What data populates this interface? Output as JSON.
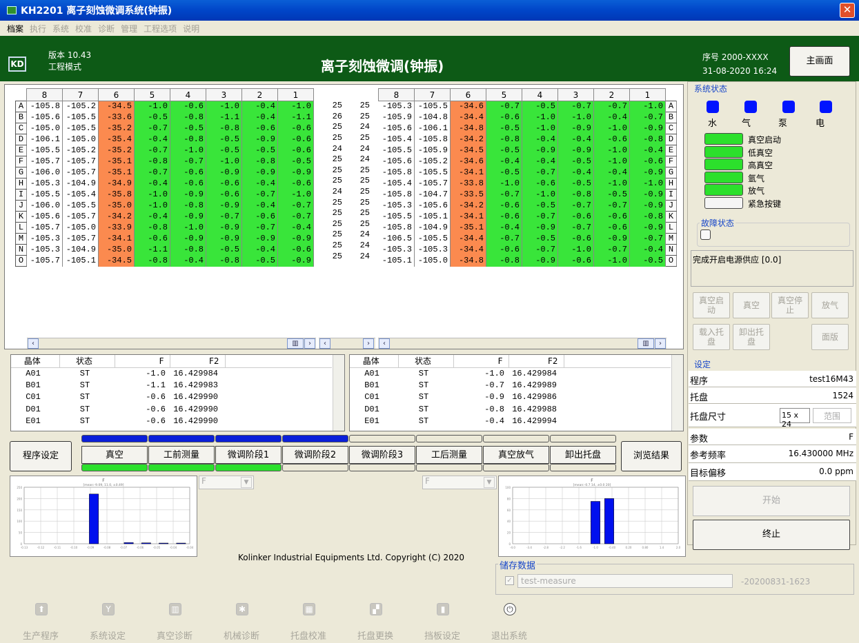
{
  "window": {
    "title": "KH2201 离子刻蚀微调系统(钟振)",
    "close": "✕"
  },
  "menu": [
    "档案",
    "执行",
    "系统",
    "校准",
    "诊断",
    "管理",
    "工程选项",
    "说明"
  ],
  "header": {
    "version": "版本 10.43",
    "mode": "工程模式",
    "title": "离子刻蚀微调(钟振)",
    "serial": "序号 2000-XXXX",
    "datetime": "31-08-2020 16:24",
    "main_button": "主画面"
  },
  "grid": {
    "columns": [
      "8",
      "7",
      "6",
      "5",
      "4",
      "3",
      "2",
      "1"
    ],
    "rows": [
      "A",
      "B",
      "C",
      "D",
      "E",
      "F",
      "G",
      "H",
      "I",
      "J",
      "K",
      "L",
      "M",
      "N",
      "O"
    ],
    "left": [
      [
        "-105.8",
        "-105.2",
        "-34.5",
        "-1.0",
        "-0.6",
        "-1.0",
        "-0.4",
        "-1.0"
      ],
      [
        "-105.6",
        "-105.5",
        "-33.6",
        "-0.5",
        "-0.8",
        "-1.1",
        "-0.4",
        "-1.1"
      ],
      [
        "-105.0",
        "-105.5",
        "-35.2",
        "-0.7",
        "-0.5",
        "-0.8",
        "-0.6",
        "-0.6"
      ],
      [
        "-106.1",
        "-105.0",
        "-35.4",
        "-0.4",
        "-0.8",
        "-0.5",
        "-0.9",
        "-0.6"
      ],
      [
        "-105.5",
        "-105.2",
        "-35.2",
        "-0.7",
        "-1.0",
        "-0.5",
        "-0.5",
        "-0.6"
      ],
      [
        "-105.7",
        "-105.7",
        "-35.1",
        "-0.8",
        "-0.7",
        "-1.0",
        "-0.8",
        "-0.5"
      ],
      [
        "-106.0",
        "-105.7",
        "-35.1",
        "-0.7",
        "-0.6",
        "-0.9",
        "-0.9",
        "-0.9"
      ],
      [
        "-105.3",
        "-104.9",
        "-34.9",
        "-0.4",
        "-0.6",
        "-0.6",
        "-0.4",
        "-0.6"
      ],
      [
        "-105.5",
        "-105.4",
        "-35.8",
        "-1.0",
        "-0.9",
        "-0.6",
        "-0.7",
        "-1.0"
      ],
      [
        "-106.0",
        "-105.5",
        "-35.0",
        "-1.0",
        "-0.8",
        "-0.9",
        "-0.4",
        "-0.7"
      ],
      [
        "-105.6",
        "-105.7",
        "-34.2",
        "-0.4",
        "-0.9",
        "-0.7",
        "-0.6",
        "-0.7"
      ],
      [
        "-105.7",
        "-105.0",
        "-33.9",
        "-0.8",
        "-1.0",
        "-0.9",
        "-0.7",
        "-0.4"
      ],
      [
        "-105.3",
        "-105.7",
        "-34.1",
        "-0.6",
        "-0.9",
        "-0.9",
        "-0.9",
        "-0.9"
      ],
      [
        "-105.3",
        "-104.9",
        "-35.0",
        "-1.1",
        "-0.8",
        "-0.5",
        "-0.4",
        "-0.6"
      ],
      [
        "-105.7",
        "-105.1",
        "-34.5",
        "-0.8",
        "-0.4",
        "-0.8",
        "-0.5",
        "-0.9"
      ]
    ],
    "middle": [
      [
        "25",
        "25"
      ],
      [
        "26",
        "25"
      ],
      [
        "25",
        "24"
      ],
      [
        "25",
        "25"
      ],
      [
        "24",
        "24"
      ],
      [
        "25",
        "24"
      ],
      [
        "25",
        "25"
      ],
      [
        "25",
        "25"
      ],
      [
        "24",
        "25"
      ],
      [
        "25",
        "25"
      ],
      [
        "25",
        "25"
      ],
      [
        "25",
        "25"
      ],
      [
        "25",
        "24"
      ],
      [
        "25",
        "24"
      ],
      [
        "25",
        "24"
      ]
    ],
    "right": [
      [
        "-105.3",
        "-105.5",
        "-34.6",
        "-0.7",
        "-0.5",
        "-0.7",
        "-0.7",
        "-1.0"
      ],
      [
        "-105.9",
        "-104.8",
        "-34.4",
        "-0.6",
        "-1.0",
        "-1.0",
        "-0.4",
        "-0.7"
      ],
      [
        "-105.6",
        "-106.1",
        "-34.8",
        "-0.5",
        "-1.0",
        "-0.9",
        "-1.0",
        "-0.9"
      ],
      [
        "-105.4",
        "-105.8",
        "-34.2",
        "-0.8",
        "-0.4",
        "-0.4",
        "-0.6",
        "-0.8"
      ],
      [
        "-105.5",
        "-105.9",
        "-34.5",
        "-0.5",
        "-0.9",
        "-0.9",
        "-1.0",
        "-0.4"
      ],
      [
        "-105.6",
        "-105.2",
        "-34.6",
        "-0.4",
        "-0.4",
        "-0.5",
        "-1.0",
        "-0.6"
      ],
      [
        "-105.8",
        "-105.5",
        "-34.1",
        "-0.5",
        "-0.7",
        "-0.4",
        "-0.4",
        "-0.9"
      ],
      [
        "-105.4",
        "-105.7",
        "-33.8",
        "-1.0",
        "-0.6",
        "-0.5",
        "-1.0",
        "-1.0"
      ],
      [
        "-105.8",
        "-104.7",
        "-33.5",
        "-0.7",
        "-1.0",
        "-0.8",
        "-0.5",
        "-0.9"
      ],
      [
        "-105.3",
        "-105.6",
        "-34.2",
        "-0.6",
        "-0.5",
        "-0.7",
        "-0.7",
        "-0.9"
      ],
      [
        "-105.5",
        "-105.1",
        "-34.1",
        "-0.6",
        "-0.7",
        "-0.6",
        "-0.6",
        "-0.8"
      ],
      [
        "-105.8",
        "-104.9",
        "-35.1",
        "-0.4",
        "-0.9",
        "-0.7",
        "-0.6",
        "-0.9"
      ],
      [
        "-106.5",
        "-105.5",
        "-34.4",
        "-0.7",
        "-0.5",
        "-0.6",
        "-0.9",
        "-0.7"
      ],
      [
        "-105.3",
        "-105.3",
        "-34.4",
        "-0.6",
        "-0.7",
        "-1.0",
        "-0.7",
        "-0.4"
      ],
      [
        "-105.1",
        "-105.0",
        "-34.8",
        "-0.8",
        "-0.9",
        "-0.6",
        "-1.0",
        "-0.5"
      ]
    ]
  },
  "crystal_table": {
    "headers": [
      "晶体",
      "状态",
      "F",
      "F2"
    ],
    "left": [
      [
        "A01",
        "ST",
        "-1.0",
        "16.429984"
      ],
      [
        "B01",
        "ST",
        "-1.1",
        "16.429983"
      ],
      [
        "C01",
        "ST",
        "-0.6",
        "16.429990"
      ],
      [
        "D01",
        "ST",
        "-0.6",
        "16.429990"
      ],
      [
        "E01",
        "ST",
        "-0.6",
        "16.429990"
      ]
    ],
    "right": [
      [
        "A01",
        "ST",
        "-1.0",
        "16.429984"
      ],
      [
        "B01",
        "ST",
        "-0.7",
        "16.429989"
      ],
      [
        "C01",
        "ST",
        "-0.9",
        "16.429986"
      ],
      [
        "D01",
        "ST",
        "-0.8",
        "16.429988"
      ],
      [
        "E01",
        "ST",
        "-0.4",
        "16.429994"
      ]
    ]
  },
  "stages": {
    "program_button": "程序设定",
    "browse_button": "浏览结果",
    "items": [
      {
        "label": "真空",
        "top": "#0a1fd9",
        "bottom": "#2ce02c"
      },
      {
        "label": "工前测量",
        "top": "#0a1fd9",
        "bottom": "#2ce02c"
      },
      {
        "label": "微调阶段1",
        "top": "#0a1fd9",
        "bottom": "#2ce02c"
      },
      {
        "label": "微调阶段2",
        "top": "#0a1fd9",
        "bottom": "#ece9d8"
      },
      {
        "label": "微调阶段3",
        "top": "#ece9d8",
        "bottom": "#ece9d8"
      },
      {
        "label": "工后测量",
        "top": "#ece9d8",
        "bottom": "#ece9d8"
      },
      {
        "label": "真空放气",
        "top": "#ece9d8",
        "bottom": "#ece9d8"
      },
      {
        "label": "卸出托盘",
        "top": "#ece9d8",
        "bottom": "#ece9d8"
      }
    ]
  },
  "system_status": {
    "title": "系统状态",
    "indicators": [
      "水",
      "气",
      "泵",
      "电"
    ],
    "lamps": [
      {
        "label": "真空启动",
        "on": true
      },
      {
        "label": "低真空",
        "on": true
      },
      {
        "label": "高真空",
        "on": true
      },
      {
        "label": "氩气",
        "on": true
      },
      {
        "label": "放气",
        "on": true
      },
      {
        "label": "紧急按键",
        "on": false
      }
    ]
  },
  "fault": {
    "title": "故障状态",
    "message": "完成开启电源供应 [0.0]"
  },
  "controls": {
    "vac_start": "真空启动",
    "vac": "真空",
    "vac_stop": "真空停止",
    "vent": "放气",
    "load": "载入托盘",
    "unload": "卸出托盘",
    "panel": "面版"
  },
  "settings": {
    "title": "设定",
    "program_label": "程序",
    "program": "test16M43",
    "tray_label": "托盘",
    "tray": "1524",
    "size_label": "托盘尺寸",
    "size": "15 x 24",
    "range_button": "范围",
    "param_label": "参数",
    "param": "F",
    "ref_label": "参考频率",
    "ref": "16.430000 MHz",
    "target_label": "目标偏移",
    "target": "0.0 ppm"
  },
  "actions": {
    "start": "开始",
    "stop": "终止"
  },
  "dropdowns": {
    "left": "F",
    "right": "F"
  },
  "charts": {
    "left_title": "F",
    "left_sub": "[mean:-9.09, 11.0, ±0.49]",
    "right_title": "F",
    "right_sub": "[mean:-0.7 14, ±0.0 20]"
  },
  "chart_data": [
    {
      "type": "bar",
      "title": "F",
      "x": [
        -0.09,
        -0.07,
        -0.06,
        -0.05,
        -0.04
      ],
      "values": [
        220,
        5,
        4,
        3,
        3
      ],
      "ylim": [
        0,
        250
      ],
      "xlim": [
        -0.13,
        -0.035
      ]
    },
    {
      "type": "bar",
      "title": "F",
      "x": [
        -1.0,
        -0.5
      ],
      "values": [
        75,
        80
      ],
      "ylim": [
        0,
        100
      ],
      "xlim": [
        -4.0,
        2.0
      ]
    }
  ],
  "copyright": "Kolinker Industrial Equipments Ltd. Copyright (C) 2020",
  "storage": {
    "title": "储存数据",
    "name": "test-measure",
    "suffix": "-20200831-1623"
  },
  "footer": [
    "生产程序",
    "系统设定",
    "真空诊断",
    "机械诊断",
    "托盘校准",
    "托盘更换",
    "挡板设定",
    "退出系统"
  ]
}
